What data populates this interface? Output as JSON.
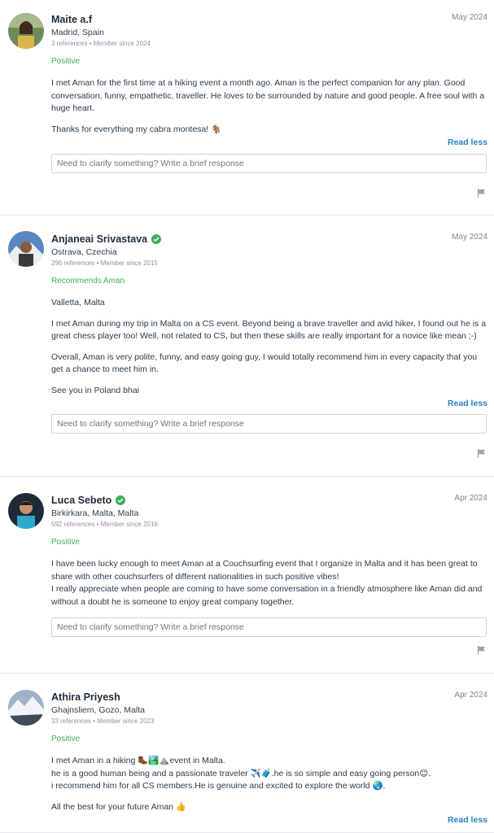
{
  "reviews": [
    {
      "name": "Maite a.f",
      "date": "May 2024",
      "location": "Madrid, Spain",
      "meta": "3 references • Member since 2024",
      "status": "Positive",
      "paragraphs": [
        "I met Aman for the first time at a hiking event a month ago. Aman is the perfect companion for any plan. Good conversation, funny, empathetic, traveller. He loves to be surrounded by nature and good people. A free soul with a huge heart.",
        "Thanks for everything my cabra montesa! 🐐"
      ],
      "read_less": "Read less",
      "response_placeholder": "Need to clarify something? Write a brief response"
    },
    {
      "name": "Anjaneai Srivastava",
      "date": "May 2024",
      "location": "Ostrava, Czechia",
      "meta": "296 references • Member since 2015",
      "status": "Recommends Aman",
      "paragraphs": [
        "Valletta, Malta",
        "I met Aman during my trip in Malta on a CS event. Beyond being a brave traveller and avid hiker, I found out he is a great chess player too! Well, not related to CS, but then these skills are really important for a novice like mean ;-)",
        "Overall, Aman is very polite, funny, and easy going guy, I would totally recommend him in every capacity that you get a chance to meet him in.",
        "See you in Poland bhai"
      ],
      "read_less": "Read less",
      "response_placeholder": "Need to clarify something? Write a brief response"
    },
    {
      "name": "Luca Sebeto",
      "date": "Apr 2024",
      "location": "Birkirkara, Malta, Malta",
      "meta": "592 references • Member since 2016",
      "status": "Positive",
      "paragraphs": [
        "I have been lucky enough to meet Aman at a Couchsurfing event that I organize in Malta and it has been great to share with other couchsurfers of different nationalities in such positive vibes!",
        "I really appreciate when people are coming to have some conversation in a friendly atmosphere like Aman did and without a doubt he is someone to enjoy great company together."
      ],
      "read_less": "",
      "response_placeholder": "Need to clarify something? Write a brief response"
    },
    {
      "name": "Athira Priyesh",
      "date": "Apr 2024",
      "location": "Ghajnsliem, Gozo, Malta",
      "meta": "33 references • Member since 2023",
      "status": "Positive",
      "paragraphs": [
        "I met Aman in a hiking 🥾🏞️⛰️event in Malta.",
        "he is a good human being and a passionate traveler ✈️🧳.he is so simple and easy going person😊.",
        "i recommend him for all CS members.He is genuine and excited to explore the world 🌏.",
        "All the best for your future Aman 👍"
      ],
      "read_less": "Read less",
      "response_placeholder": ""
    }
  ]
}
